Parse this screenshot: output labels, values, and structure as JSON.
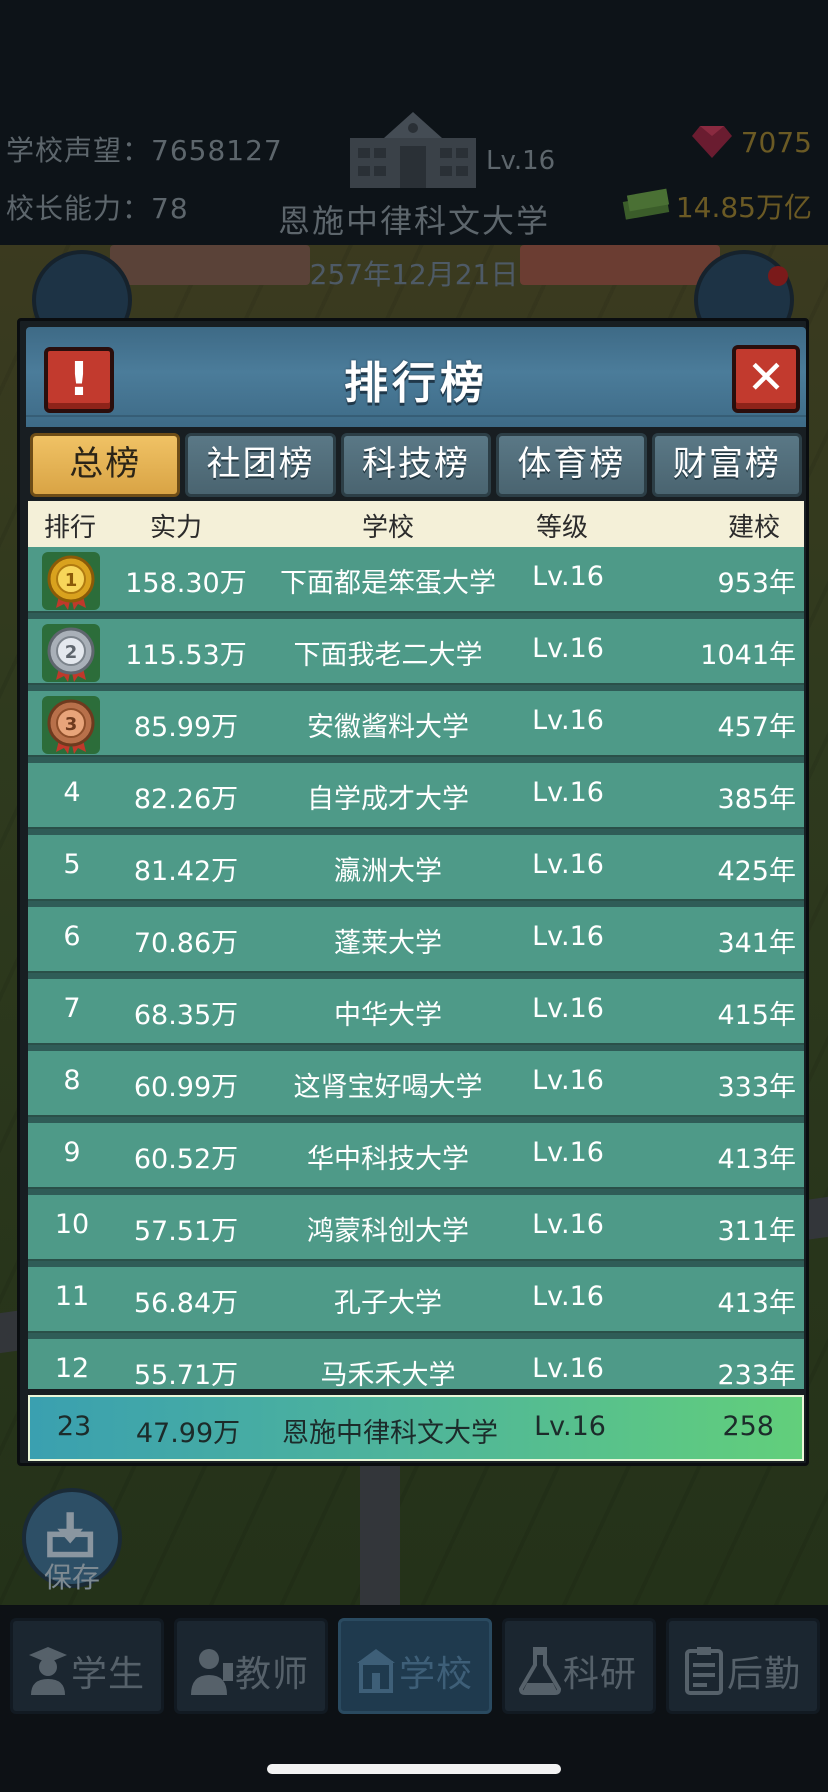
{
  "hud": {
    "reputation_label": "学校声望：",
    "reputation_value": "7658127",
    "principal_label": "校长能力：",
    "principal_value": "78",
    "school_level": "Lv.16",
    "school_name": "恩施中律科文大学",
    "gems": "7075",
    "money": "14.85万亿",
    "date": "257年12月21日"
  },
  "modal": {
    "title": "排行榜",
    "alert_icon": "!",
    "close_icon": "✕"
  },
  "tabs": [
    {
      "label": "总榜",
      "active": true
    },
    {
      "label": "社团榜",
      "active": false
    },
    {
      "label": "科技榜",
      "active": false
    },
    {
      "label": "体育榜",
      "active": false
    },
    {
      "label": "财富榜",
      "active": false
    }
  ],
  "columns": {
    "rank": "排行",
    "power": "实力",
    "school": "学校",
    "level": "等级",
    "founded": "建校"
  },
  "rows": [
    {
      "rank": "1",
      "medal": "gold-medal-icon",
      "power": "158.30万",
      "school": "下面都是笨蛋大学",
      "level": "Lv.16",
      "founded": "953年"
    },
    {
      "rank": "2",
      "medal": "silver-medal-icon",
      "power": "115.53万",
      "school": "下面我老二大学",
      "level": "Lv.16",
      "founded": "1041年"
    },
    {
      "rank": "3",
      "medal": "bronze-medal-icon",
      "power": "85.99万",
      "school": "安徽酱料大学",
      "level": "Lv.16",
      "founded": "457年"
    },
    {
      "rank": "4",
      "power": "82.26万",
      "school": "自学成才大学",
      "level": "Lv.16",
      "founded": "385年"
    },
    {
      "rank": "5",
      "power": "81.42万",
      "school": "瀛洲大学",
      "level": "Lv.16",
      "founded": "425年"
    },
    {
      "rank": "6",
      "power": "70.86万",
      "school": "蓬莱大学",
      "level": "Lv.16",
      "founded": "341年"
    },
    {
      "rank": "7",
      "power": "68.35万",
      "school": "中华大学",
      "level": "Lv.16",
      "founded": "415年"
    },
    {
      "rank": "8",
      "power": "60.99万",
      "school": "这肾宝好喝大学",
      "level": "Lv.16",
      "founded": "333年"
    },
    {
      "rank": "9",
      "power": "60.52万",
      "school": "华中科技大学",
      "level": "Lv.16",
      "founded": "413年"
    },
    {
      "rank": "10",
      "power": "57.51万",
      "school": "鸿蒙科创大学",
      "level": "Lv.16",
      "founded": "311年"
    },
    {
      "rank": "11",
      "power": "56.84万",
      "school": "孔子大学",
      "level": "Lv.16",
      "founded": "413年"
    },
    {
      "rank": "12",
      "power": "55.71万",
      "school": "马禾禾大学",
      "level": "Lv.16",
      "founded": "233年"
    }
  ],
  "self_row": {
    "rank": "23",
    "power": "47.99万",
    "school": "恩施中律科文大学",
    "level": "Lv.16",
    "founded": "258"
  },
  "save": {
    "label": "保存"
  },
  "nav": [
    {
      "label": "学生",
      "icon": "student-icon",
      "active": false
    },
    {
      "label": "教师",
      "icon": "teacher-icon",
      "active": false
    },
    {
      "label": "学校",
      "icon": "school-icon",
      "active": true
    },
    {
      "label": "科研",
      "icon": "flask-icon",
      "active": false
    },
    {
      "label": "后勤",
      "icon": "clipboard-icon",
      "active": false
    }
  ],
  "colors": {
    "row_bg": "#4e9a88",
    "active_tab": "#e3b04f",
    "header_blue": "#4b7c9a",
    "close_red": "#c23a2e"
  }
}
